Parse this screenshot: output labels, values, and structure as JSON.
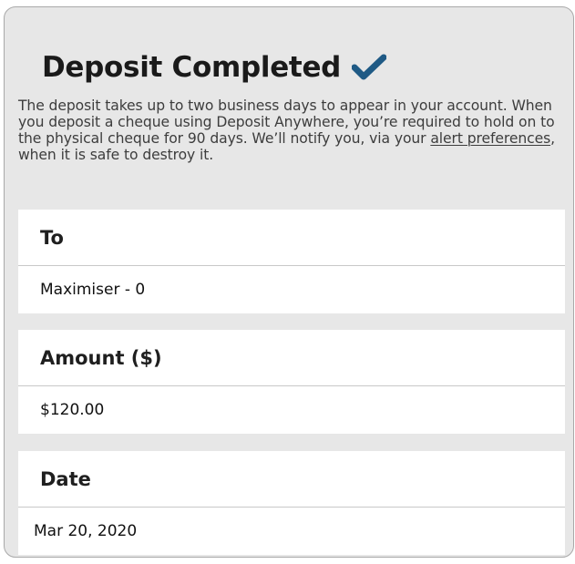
{
  "header": {
    "title": "Deposit Completed",
    "icon": "checkmark-icon",
    "icon_color": "#1f5a85"
  },
  "description": {
    "text_before_link": "The deposit takes up to two business days to appear in your account. When you deposit a cheque using Deposit Anywhere, you’re required to hold on to the physical cheque for 90 days. We’ll notify you, via your ",
    "link_text": "alert preferences",
    "text_after_link": ", when it is safe to destroy it."
  },
  "details": {
    "to": {
      "label": "To",
      "value": "Maximiser - 0"
    },
    "amount": {
      "label": "Amount ($)",
      "value": "$120.00"
    },
    "date": {
      "label": "Date",
      "value": "Mar 20, 2020"
    }
  },
  "colors": {
    "card_background": "#e7e7e7",
    "section_background": "#ffffff",
    "checkmark": "#1f5a85"
  }
}
